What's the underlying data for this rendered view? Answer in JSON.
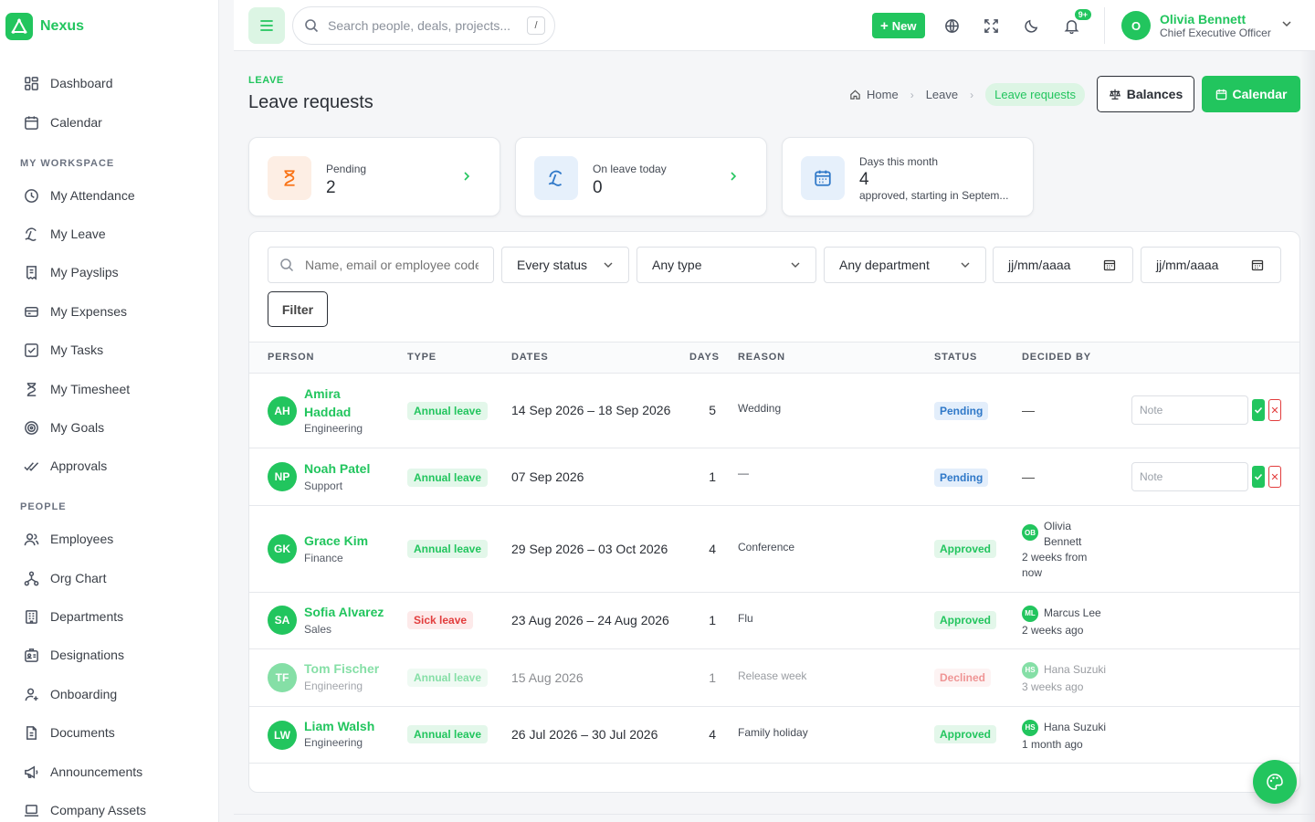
{
  "app": {
    "name": "Nexus"
  },
  "sidebar": {
    "top_items": [
      {
        "label": "Dashboard",
        "icon": "grid-icon"
      },
      {
        "label": "Calendar",
        "icon": "calendar-icon"
      }
    ],
    "sections": [
      {
        "title": "MY WORKSPACE",
        "items": [
          {
            "label": "My Attendance",
            "icon": "clock-icon"
          },
          {
            "label": "My Leave",
            "icon": "beach-icon"
          },
          {
            "label": "My Payslips",
            "icon": "receipt-icon"
          },
          {
            "label": "My Expenses",
            "icon": "card-icon"
          },
          {
            "label": "My Tasks",
            "icon": "check-square-icon"
          },
          {
            "label": "My Timesheet",
            "icon": "hourglass-icon"
          },
          {
            "label": "My Goals",
            "icon": "target-icon"
          },
          {
            "label": "Approvals",
            "icon": "double-check-icon"
          }
        ]
      },
      {
        "title": "PEOPLE",
        "items": [
          {
            "label": "Employees",
            "icon": "users-icon"
          },
          {
            "label": "Org Chart",
            "icon": "org-chart-icon"
          },
          {
            "label": "Departments",
            "icon": "building-icon"
          },
          {
            "label": "Designations",
            "icon": "id-badge-icon"
          },
          {
            "label": "Onboarding",
            "icon": "user-plus-icon"
          },
          {
            "label": "Documents",
            "icon": "document-icon"
          },
          {
            "label": "Announcements",
            "icon": "megaphone-icon"
          },
          {
            "label": "Company Assets",
            "icon": "laptop-icon"
          }
        ]
      }
    ]
  },
  "topbar": {
    "search_placeholder": "Search people, deals, projects...",
    "search_shortcut": "/",
    "new_label": "New",
    "notification_badge": "9+",
    "user": {
      "initial": "O",
      "name": "Olivia Bennett",
      "role": "Chief Executive Officer"
    }
  },
  "page": {
    "eyebrow": "LEAVE",
    "title": "Leave requests",
    "breadcrumb": [
      "Home",
      "Leave",
      "Leave requests"
    ],
    "balances_label": "Balances",
    "calendar_label": "Calendar"
  },
  "stats": [
    {
      "label": "Pending",
      "value": "2",
      "icon": "hourglass-icon",
      "color": "#f97316",
      "bg": "#fdeee4"
    },
    {
      "label": "On leave today",
      "value": "0",
      "icon": "beach-icon",
      "color": "#2f78c8",
      "bg": "#e6f0fb"
    },
    {
      "label": "Days this month",
      "value": "4",
      "sub": "approved, starting in Septem...",
      "icon": "calendar-icon",
      "color": "#2f78c8",
      "bg": "#e6f0fb"
    }
  ],
  "filters": {
    "search_placeholder": "Name, email or employee code",
    "status": "Every status",
    "type": "Any type",
    "department": "Any department",
    "date_from_placeholder": "jj/mm/aaaa",
    "date_to_placeholder": "jj/mm/aaaa",
    "filter_label": "Filter"
  },
  "table": {
    "headers": [
      "PERSON",
      "TYPE",
      "DATES",
      "DAYS",
      "REASON",
      "STATUS",
      "DECIDED BY"
    ],
    "note_placeholder": "Note",
    "rows": [
      {
        "initials": "AH",
        "name": "Amira Haddad",
        "dept": "Engineering",
        "type": "Annual leave",
        "dates": "14 Sep 2026 – 18 Sep 2026",
        "days": "5",
        "reason": "Wedding",
        "status": "Pending",
        "decided": "—"
      },
      {
        "initials": "NP",
        "name": "Noah Patel",
        "dept": "Support",
        "type": "Annual leave",
        "dates": "07 Sep 2026",
        "days": "1",
        "reason": "—",
        "status": "Pending",
        "decided": "—"
      },
      {
        "initials": "GK",
        "name": "Grace Kim",
        "dept": "Finance",
        "type": "Annual leave",
        "dates": "29 Sep 2026 – 03 Oct 2026",
        "days": "4",
        "reason": "Conference",
        "status": "Approved",
        "decider_initials": "OB",
        "decider": "Olivia Bennett",
        "decided_when": "2 weeks from now"
      },
      {
        "initials": "SA",
        "name": "Sofia Alvarez",
        "dept": "Sales",
        "type": "Sick leave",
        "dates": "23 Aug 2026 – 24 Aug 2026",
        "days": "1",
        "reason": "Flu",
        "status": "Approved",
        "decider_initials": "ML",
        "decider": "Marcus Lee",
        "decided_when": "2 weeks ago"
      },
      {
        "initials": "TF",
        "name": "Tom Fischer",
        "dept": "Engineering",
        "type": "Annual leave",
        "dates": "15 Aug 2026",
        "days": "1",
        "reason": "Release week",
        "status": "Declined",
        "decider_initials": "HS",
        "decider": "Hana Suzuki",
        "decided_when": "3 weeks ago"
      },
      {
        "initials": "LW",
        "name": "Liam Walsh",
        "dept": "Engineering",
        "type": "Annual leave",
        "dates": "26 Jul 2026 – 30 Jul 2026",
        "days": "4",
        "reason": "Family holiday",
        "status": "Approved",
        "decider_initials": "HS",
        "decider": "Hana Suzuki",
        "decided_when": "1 month ago"
      }
    ]
  },
  "colors": {
    "accent": "#22c55e",
    "pending": "#2f78c8",
    "declined": "#e23d3d"
  }
}
